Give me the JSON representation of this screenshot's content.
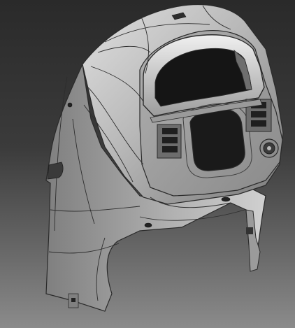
{
  "scene": {
    "subject": "3d-part-render",
    "style": "shaded-with-edges",
    "colors": {
      "background_top": "#2a2a2a",
      "background_bottom": "#8b8b8b",
      "surface_light": "#d7d7d7",
      "surface_mid": "#a9a9a9",
      "surface_dark": "#5e5e5e",
      "edge": "#2a2a2a"
    }
  }
}
